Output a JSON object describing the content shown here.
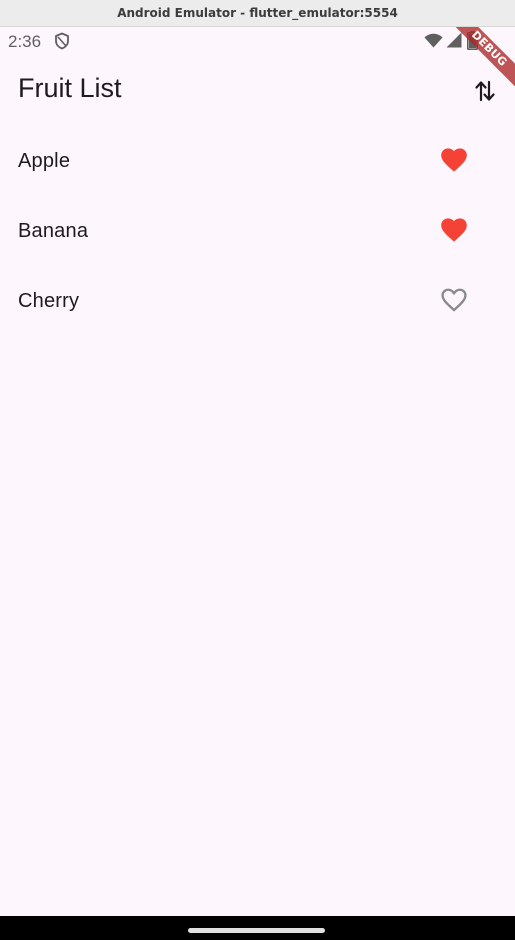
{
  "window": {
    "title": "Android Emulator - flutter_emulator:5554"
  },
  "status_bar": {
    "time": "2:36",
    "icons": [
      "shield-icon",
      "wifi-icon",
      "cell-signal-icon",
      "battery-icon"
    ]
  },
  "debug_banner": {
    "label": "DEBUG",
    "color": "#ad2626"
  },
  "app_bar": {
    "title": "Fruit List",
    "action_icon": "sort-icon"
  },
  "fruits": [
    {
      "name": "Apple",
      "favorite": true
    },
    {
      "name": "Banana",
      "favorite": true
    },
    {
      "name": "Cherry",
      "favorite": false
    }
  ],
  "colors": {
    "background": "#fdf6fd",
    "favorite": "#f44336",
    "not_favorite": "#8a8a8a",
    "text": "#1d1b20"
  }
}
